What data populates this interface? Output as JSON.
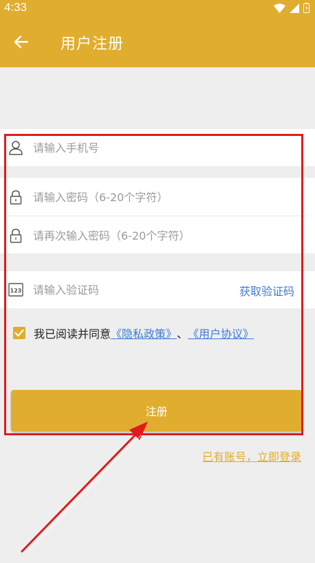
{
  "status_bar": {
    "time": "4:33"
  },
  "app_bar": {
    "title": "用户注册"
  },
  "form": {
    "phone_placeholder": "请输入手机号",
    "password_placeholder": "请输入密码（6-20个字符）",
    "confirm_placeholder": "请再次输入密码（6-20个字符）",
    "code_placeholder": "请输入验证码",
    "get_code_label": "获取验证码",
    "agree_prefix": "我已阅读并同意",
    "privacy_link": "《隐私政策》",
    "separator": "、",
    "terms_link": "《用户协议》",
    "agree_checked": true,
    "register_label": "注册",
    "login_link": "已有账号，立即登录"
  },
  "colors": {
    "primary": "#e0ad2e",
    "link": "#3d7bd6",
    "annotation": "#e01b1b",
    "background": "#eeeeee"
  },
  "icons": {
    "user": "user-icon",
    "lock": "lock-icon",
    "code": "code-123-icon",
    "check": "check-icon",
    "back": "arrow-left-icon"
  }
}
